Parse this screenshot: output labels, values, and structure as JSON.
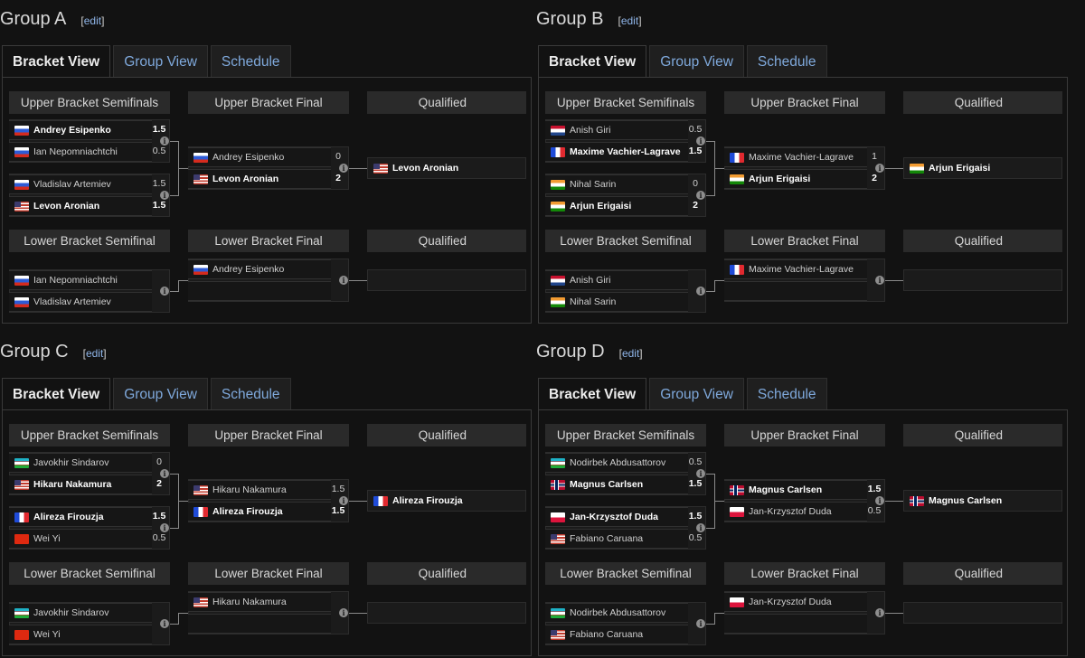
{
  "labels": {
    "edit": "edit",
    "tabs": [
      "Bracket View",
      "Group View",
      "Schedule"
    ],
    "ub_semis": "Upper Bracket Semifinals",
    "ub_final": "Upper Bracket Final",
    "qualified": "Qualified",
    "lb_semi": "Lower Bracket Semifinal",
    "lb_final": "Lower Bracket Final",
    "info_glyph": "i"
  },
  "groups": [
    {
      "title": "Group A",
      "ub_semi1": {
        "p1": {
          "name": "Andrey Esipenko",
          "flag": "ru",
          "score": "1.5",
          "win": true
        },
        "p2": {
          "name": "Ian Nepomniachtchi",
          "flag": "ru",
          "score": "0.5",
          "win": false
        }
      },
      "ub_semi2": {
        "p1": {
          "name": "Vladislav Artemiev",
          "flag": "ru",
          "score": "1.5",
          "win": false
        },
        "p2": {
          "name": "Levon Aronian",
          "flag": "us",
          "score": "1.5",
          "win": true
        }
      },
      "ub_final": {
        "p1": {
          "name": "Andrey Esipenko",
          "flag": "ru",
          "score": "0",
          "win": false
        },
        "p2": {
          "name": "Levon Aronian",
          "flag": "us",
          "score": "2",
          "win": true
        }
      },
      "ub_qualified": {
        "name": "Levon Aronian",
        "flag": "us"
      },
      "lb_semi": {
        "p1": {
          "name": "Ian Nepomniachtchi",
          "flag": "ru",
          "score": "",
          "win": false
        },
        "p2": {
          "name": "Vladislav Artemiev",
          "flag": "ru",
          "score": "",
          "win": false
        }
      },
      "lb_final": {
        "p1": {
          "name": "Andrey Esipenko",
          "flag": "ru",
          "score": "",
          "win": false
        },
        "p2": {
          "name": "",
          "flag": "",
          "score": "",
          "win": false
        }
      },
      "lb_qualified": {
        "name": "",
        "flag": ""
      }
    },
    {
      "title": "Group B",
      "ub_semi1": {
        "p1": {
          "name": "Anish Giri",
          "flag": "nl",
          "score": "0.5",
          "win": false
        },
        "p2": {
          "name": "Maxime Vachier-Lagrave",
          "flag": "fr",
          "score": "1.5",
          "win": true
        }
      },
      "ub_semi2": {
        "p1": {
          "name": "Nihal Sarin",
          "flag": "in",
          "score": "0",
          "win": false
        },
        "p2": {
          "name": "Arjun Erigaisi",
          "flag": "in",
          "score": "2",
          "win": true
        }
      },
      "ub_final": {
        "p1": {
          "name": "Maxime Vachier-Lagrave",
          "flag": "fr",
          "score": "1",
          "win": false
        },
        "p2": {
          "name": "Arjun Erigaisi",
          "flag": "in",
          "score": "2",
          "win": true
        }
      },
      "ub_qualified": {
        "name": "Arjun Erigaisi",
        "flag": "in"
      },
      "lb_semi": {
        "p1": {
          "name": "Anish Giri",
          "flag": "nl",
          "score": "",
          "win": false
        },
        "p2": {
          "name": "Nihal Sarin",
          "flag": "in",
          "score": "",
          "win": false
        }
      },
      "lb_final": {
        "p1": {
          "name": "Maxime Vachier-Lagrave",
          "flag": "fr",
          "score": "",
          "win": false
        },
        "p2": {
          "name": "",
          "flag": "",
          "score": "",
          "win": false
        }
      },
      "lb_qualified": {
        "name": "",
        "flag": ""
      }
    },
    {
      "title": "Group C",
      "ub_semi1": {
        "p1": {
          "name": "Javokhir Sindarov",
          "flag": "uz",
          "score": "0",
          "win": false
        },
        "p2": {
          "name": "Hikaru Nakamura",
          "flag": "us",
          "score": "2",
          "win": true
        }
      },
      "ub_semi2": {
        "p1": {
          "name": "Alireza Firouzja",
          "flag": "fr",
          "score": "1.5",
          "win": true
        },
        "p2": {
          "name": "Wei Yi",
          "flag": "cn",
          "score": "0.5",
          "win": false
        }
      },
      "ub_final": {
        "p1": {
          "name": "Hikaru Nakamura",
          "flag": "us",
          "score": "1.5",
          "win": false
        },
        "p2": {
          "name": "Alireza Firouzja",
          "flag": "fr",
          "score": "1.5",
          "win": true
        }
      },
      "ub_qualified": {
        "name": "Alireza Firouzja",
        "flag": "fr"
      },
      "lb_semi": {
        "p1": {
          "name": "Javokhir Sindarov",
          "flag": "uz",
          "score": "",
          "win": false
        },
        "p2": {
          "name": "Wei Yi",
          "flag": "cn",
          "score": "",
          "win": false
        }
      },
      "lb_final": {
        "p1": {
          "name": "Hikaru Nakamura",
          "flag": "us",
          "score": "",
          "win": false
        },
        "p2": {
          "name": "",
          "flag": "",
          "score": "",
          "win": false
        }
      },
      "lb_qualified": {
        "name": "",
        "flag": ""
      }
    },
    {
      "title": "Group D",
      "ub_semi1": {
        "p1": {
          "name": "Nodirbek Abdusattorov",
          "flag": "uz",
          "score": "0.5",
          "win": false
        },
        "p2": {
          "name": "Magnus Carlsen",
          "flag": "no",
          "score": "1.5",
          "win": true
        }
      },
      "ub_semi2": {
        "p1": {
          "name": "Jan-Krzysztof Duda",
          "flag": "pl",
          "score": "1.5",
          "win": true
        },
        "p2": {
          "name": "Fabiano Caruana",
          "flag": "us",
          "score": "0.5",
          "win": false
        }
      },
      "ub_final": {
        "p1": {
          "name": "Magnus Carlsen",
          "flag": "no",
          "score": "1.5",
          "win": true
        },
        "p2": {
          "name": "Jan-Krzysztof Duda",
          "flag": "pl",
          "score": "0.5",
          "win": false
        }
      },
      "ub_qualified": {
        "name": "Magnus Carlsen",
        "flag": "no"
      },
      "lb_semi": {
        "p1": {
          "name": "Nodirbek Abdusattorov",
          "flag": "uz",
          "score": "",
          "win": false
        },
        "p2": {
          "name": "Fabiano Caruana",
          "flag": "us",
          "score": "",
          "win": false
        }
      },
      "lb_final": {
        "p1": {
          "name": "Jan-Krzysztof Duda",
          "flag": "pl",
          "score": "",
          "win": false
        },
        "p2": {
          "name": "",
          "flag": "",
          "score": "",
          "win": false
        }
      },
      "lb_qualified": {
        "name": "",
        "flag": ""
      }
    }
  ]
}
